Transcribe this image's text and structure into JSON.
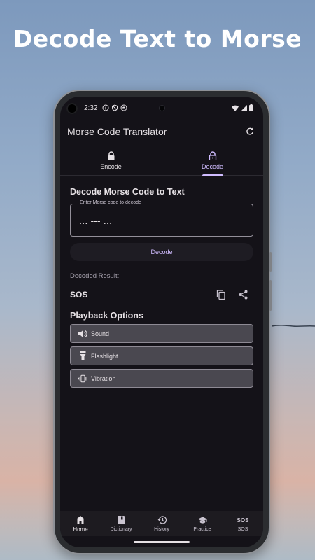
{
  "headline": "Decode Text to Morse",
  "status": {
    "time": "2:32"
  },
  "app": {
    "title": "Morse Code Translator"
  },
  "tabs": [
    {
      "label": "Encode",
      "icon": "lock-closed-icon",
      "active": false
    },
    {
      "label": "Decode",
      "icon": "lock-open-icon",
      "active": true
    }
  ],
  "decode": {
    "section_title": "Decode Morse Code to Text",
    "input_label": "Enter Morse code to decode",
    "input_value": "... --- ...",
    "button_label": "Decode",
    "result_label": "Decoded Result:",
    "result_value": "SOS"
  },
  "playback": {
    "title": "Playback Options",
    "options": [
      {
        "label": "Sound",
        "icon": "volume-icon"
      },
      {
        "label": "Flashlight",
        "icon": "flashlight-icon"
      },
      {
        "label": "Vibration",
        "icon": "vibration-icon"
      }
    ]
  },
  "bottom_nav": [
    {
      "label": "Home",
      "icon": "home-icon",
      "active": true
    },
    {
      "label": "Dictionary",
      "icon": "book-icon",
      "active": false
    },
    {
      "label": "History",
      "icon": "history-icon",
      "active": false
    },
    {
      "label": "Practice",
      "icon": "school-icon",
      "active": false
    },
    {
      "label": "SOS",
      "icon": "sos-icon",
      "glyph": "SOS",
      "active": false
    }
  ],
  "colors": {
    "accent": "#d0bcff",
    "surface": "#141218",
    "on_surface": "#e6e1e5",
    "button_fill": "#4a4850"
  }
}
